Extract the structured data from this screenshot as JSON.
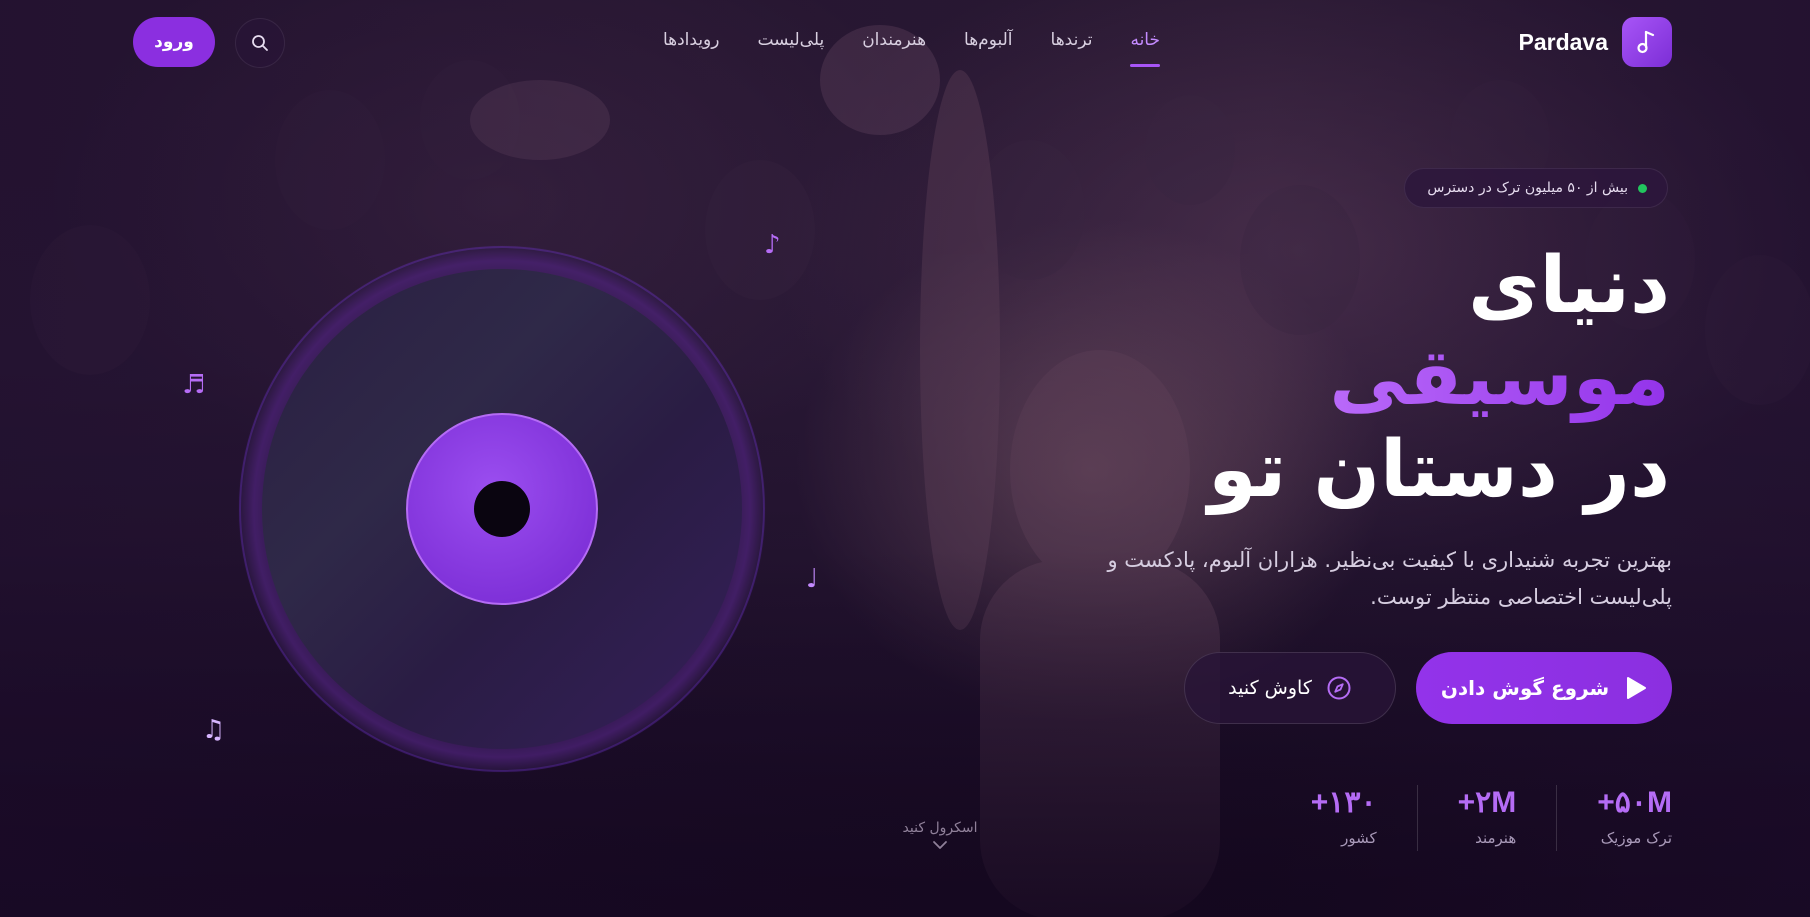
{
  "brand": {
    "name": "Pardava",
    "logo_icon": "music-note-icon"
  },
  "nav": {
    "items": [
      {
        "label": "خانه",
        "active": true
      },
      {
        "label": "ترندها",
        "active": false
      },
      {
        "label": "آلبوم‌ها",
        "active": false
      },
      {
        "label": "هنرمندان",
        "active": false
      },
      {
        "label": "پلی‌لیست",
        "active": false
      },
      {
        "label": "رویدادها",
        "active": false
      }
    ],
    "login_label": "ورود",
    "search_icon": "search-icon"
  },
  "hero": {
    "badge": "بیش از ۵۰ میلیون ترک در دسترس",
    "headline": {
      "line1": "دنیای",
      "line2": "موسیقی",
      "line3": "در دستان تو"
    },
    "subtitle_line1": "بهترین تجربه شنیداری با کیفیت بی‌نظیر. هزاران آلبوم، پادکست و",
    "subtitle_line2": "پلی‌لیست اختصاصی منتظر توست.",
    "cta_primary": "شروع گوش دادن",
    "cta_secondary": "کاوش کنید"
  },
  "stats": [
    {
      "value": "+۵۰M",
      "label": "ترک موزیک"
    },
    {
      "value": "+۲M",
      "label": "هنرمند"
    },
    {
      "value": "+۱۳۰",
      "label": "کشور"
    }
  ],
  "scroll_hint": "اسکرول کنید",
  "colors": {
    "accent": "#9333ea",
    "accent_light": "#b56cf5",
    "badge_dot": "#22c55e"
  }
}
